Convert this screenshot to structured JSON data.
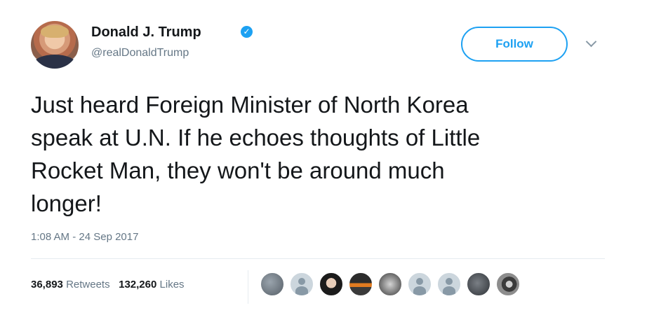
{
  "author": {
    "name": "Donald J. Trump",
    "handle": "@realDonaldTrump",
    "verified_icon": "✓"
  },
  "actions": {
    "follow_label": "Follow"
  },
  "tweet": {
    "text": "Just heard Foreign Minister of North Korea\nspeak at U.N. If he echoes thoughts of Little\nRocket Man, they won't be around much\nlonger!",
    "timestamp": "1:08 AM - 24 Sep 2017"
  },
  "stats": {
    "retweets_count": "36,893",
    "retweets_label": "Retweets",
    "likes_count": "132,260",
    "likes_label": "Likes"
  },
  "colors": {
    "accent": "#1da1f2",
    "secondary_text": "#657786"
  }
}
